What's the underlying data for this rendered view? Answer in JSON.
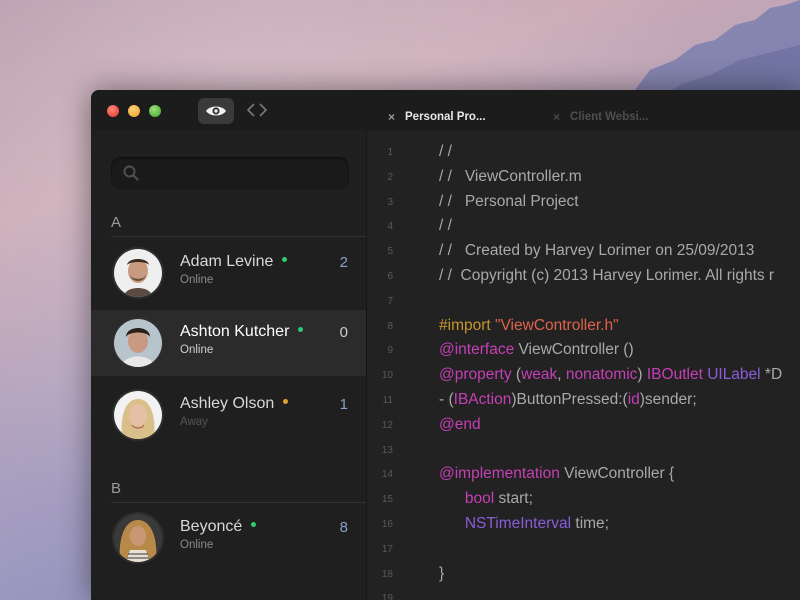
{
  "window": {
    "tabs": [
      {
        "label": "Personal Pro...",
        "close": "×",
        "active": true
      },
      {
        "label": "Client Websi...",
        "close": "×",
        "active": false
      }
    ]
  },
  "search": {
    "placeholder": ""
  },
  "sections": [
    {
      "letter": "A"
    },
    {
      "letter": "B"
    }
  ],
  "contacts": [
    {
      "name": "Adam Levine",
      "status": "Online",
      "count": "2",
      "presence_color": "#2ecc71"
    },
    {
      "name": "Ashton Kutcher",
      "status": "Online",
      "count": "0",
      "presence_color": "#2ecc71",
      "selected": true
    },
    {
      "name": "Ashley Olson",
      "status": "Away",
      "count": "1",
      "presence_color": "#e0a030"
    },
    {
      "name": "Beyoncé",
      "status": "Online",
      "count": "8",
      "presence_color": "#2ecc71"
    }
  ],
  "editor": {
    "colors": {
      "comment": "#a9a9a9",
      "keyword": "#c53fb5",
      "string": "#e0624a",
      "preprocessor": "#c7962f",
      "type": "#8c5cd8",
      "plain": "#a9a9a9"
    },
    "lines": [
      {
        "n": "1",
        "tokens": [
          {
            "t": "/ /",
            "c": "comment"
          }
        ]
      },
      {
        "n": "2",
        "tokens": [
          {
            "t": "/ /   ViewController.m",
            "c": "comment"
          }
        ]
      },
      {
        "n": "3",
        "tokens": [
          {
            "t": "/ /   Personal Project",
            "c": "comment"
          }
        ]
      },
      {
        "n": "4",
        "tokens": [
          {
            "t": "/ /",
            "c": "comment"
          }
        ]
      },
      {
        "n": "5",
        "tokens": [
          {
            "t": "/ /   Created by Harvey Lorimer on 25/09/2013",
            "c": "comment"
          }
        ]
      },
      {
        "n": "6",
        "tokens": [
          {
            "t": "/ /  Copyright (c) 2013 Harvey Lorimer. All rights r",
            "c": "comment"
          }
        ]
      },
      {
        "n": "7",
        "tokens": []
      },
      {
        "n": "8",
        "tokens": [
          {
            "t": "#import ",
            "c": "preprocessor"
          },
          {
            "t": "\"ViewController.h\"",
            "c": "string"
          }
        ]
      },
      {
        "n": "9",
        "tokens": [
          {
            "t": "@interface",
            "c": "keyword"
          },
          {
            "t": " ViewController ()",
            "c": "plain"
          }
        ]
      },
      {
        "n": "10",
        "tokens": [
          {
            "t": "@property",
            "c": "keyword"
          },
          {
            "t": " (",
            "c": "plain"
          },
          {
            "t": "weak",
            "c": "keyword"
          },
          {
            "t": ", ",
            "c": "plain"
          },
          {
            "t": "nonatomic",
            "c": "keyword"
          },
          {
            "t": ") ",
            "c": "plain"
          },
          {
            "t": "IBOutlet",
            "c": "keyword"
          },
          {
            "t": " ",
            "c": "plain"
          },
          {
            "t": "UILabel",
            "c": "type"
          },
          {
            "t": " *D",
            "c": "plain"
          }
        ]
      },
      {
        "n": "11",
        "tokens": [
          {
            "t": "- (",
            "c": "plain"
          },
          {
            "t": "IBAction",
            "c": "keyword"
          },
          {
            "t": ")ButtonPressed:(",
            "c": "plain"
          },
          {
            "t": "id",
            "c": "keyword"
          },
          {
            "t": ")sender;",
            "c": "plain"
          }
        ]
      },
      {
        "n": "12",
        "tokens": [
          {
            "t": "@end",
            "c": "keyword"
          }
        ]
      },
      {
        "n": "13",
        "tokens": []
      },
      {
        "n": "14",
        "tokens": [
          {
            "t": "@implementation",
            "c": "keyword"
          },
          {
            "t": " ViewController {",
            "c": "plain"
          }
        ]
      },
      {
        "n": "15",
        "tokens": [
          {
            "t": "      ",
            "c": "plain"
          },
          {
            "t": "bool",
            "c": "keyword"
          },
          {
            "t": " start;",
            "c": "plain"
          }
        ]
      },
      {
        "n": "16",
        "tokens": [
          {
            "t": "      ",
            "c": "plain"
          },
          {
            "t": "NSTimeInterval",
            "c": "type"
          },
          {
            "t": " time;",
            "c": "plain"
          }
        ]
      },
      {
        "n": "17",
        "tokens": []
      },
      {
        "n": "18",
        "tokens": [
          {
            "t": "}",
            "c": "plain"
          }
        ]
      },
      {
        "n": "19",
        "tokens": []
      }
    ]
  }
}
